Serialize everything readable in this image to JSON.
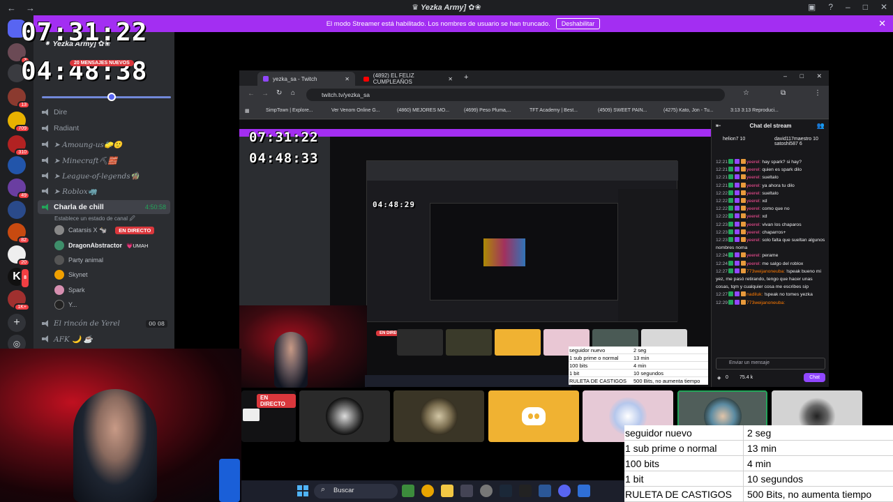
{
  "window": {
    "title": "♛ Yezka Army] ✿❀",
    "back": "←",
    "forward": "→"
  },
  "streamer_banner": {
    "message": "El modo Streamer está habilitado. Los nombres de usuario se han truncado.",
    "button": "Deshabilitar",
    "close": "✕"
  },
  "clocks": {
    "top": "07:31:22",
    "bottom": "04:48:38",
    "nested_top": "07:31:22",
    "nested_bottom": "04:48:33",
    "nested_small": "04:48:29",
    "banner_text": "20 MENSAJES NUEVOS"
  },
  "server_badges": [
    "3",
    "",
    "13",
    "709",
    "310",
    "",
    "49",
    "",
    "82",
    "20",
    "8",
    "1K+"
  ],
  "channels": {
    "server_name": "⁕ Yezka Army] ✿❀",
    "items": [
      {
        "label": "Dire",
        "italic": false
      },
      {
        "label": "Radiant",
        "italic": false
      },
      {
        "label": "➤ Amoung-us🧽🙂",
        "italic": true
      },
      {
        "label": "➤ Minecraft⛏🧱",
        "italic": true
      },
      {
        "label": "➤ League-of-legends🧌",
        "italic": true
      },
      {
        "label": "➤ Roblox🦏",
        "italic": true
      }
    ],
    "active": {
      "label": "Charla de chill",
      "timer": "4:50:58",
      "status": "Establece un estado de canal 🖉"
    },
    "users": [
      {
        "name": "Catarsis X 🐄",
        "live": "EN DIRECTO",
        "color": "#888"
      },
      {
        "name": "DragonAbstractor",
        "tag": "💗UMAH",
        "color": "#3e8e6a"
      },
      {
        "name": "Party animal",
        "color": "#555"
      },
      {
        "name": "Skynet",
        "color": "#f0a000"
      },
      {
        "name": "Spark",
        "color": "#d68fb0"
      },
      {
        "name": "Y...",
        "color": "#222"
      }
    ],
    "after": [
      {
        "label": "El rincón de Yerel",
        "counter": "00 08"
      },
      {
        "label": "AFK 🌙 ☕",
        "counter": ""
      }
    ]
  },
  "browser": {
    "tabs": [
      {
        "label": "yezka_sa - Twitch",
        "active": true
      },
      {
        "label": "(4892) EL FELIZ CUMPLEAÑOS",
        "active": false
      }
    ],
    "url": "twitch.tv/yezka_sa",
    "bookmarks": [
      "SimpTown | Explore...",
      "Ver Venom Online G...",
      "(4860) MEJORES MO...",
      "(4699) Peso Pluma,...",
      "TFT Academy | Best...",
      "(4509) SWEET PAIN...",
      "(4275) Kato, Jon - Tu...",
      "3:13 3:13 Reproduci..."
    ]
  },
  "chat": {
    "header": "Chat del stream",
    "gifts": [
      {
        "name": "helion7",
        "count": "10"
      },
      {
        "name": "david117maestro",
        "count": "10"
      },
      {
        "name": "satoshi587",
        "count": "6"
      }
    ],
    "messages": [
      {
        "time": "12:21",
        "user": "yeerel:",
        "text": "hay spark? si hay?"
      },
      {
        "time": "12:21",
        "user": "yeerel:",
        "text": "quien es spark dilo"
      },
      {
        "time": "12:21",
        "user": "yeerel:",
        "text": "sueltalo"
      },
      {
        "time": "12:21",
        "user": "yeerel:",
        "text": "ya ahora tu dilo"
      },
      {
        "time": "12:22",
        "user": "yeerel:",
        "text": "sueltalo"
      },
      {
        "time": "12:22",
        "user": "yeerel:",
        "text": "xd"
      },
      {
        "time": "12:22",
        "user": "yeerel:",
        "text": "como que no"
      },
      {
        "time": "12:22",
        "user": "yeerel:",
        "text": "xd"
      },
      {
        "time": "12:23",
        "user": "yeerel:",
        "text": "vivan los chaparos"
      },
      {
        "time": "12:23",
        "user": "yeerel:",
        "text": "chaparros+"
      },
      {
        "time": "12:23",
        "user": "yeerel:",
        "text": "solo falta que sueltan algunos nombres noma"
      },
      {
        "time": "12:24",
        "user": "yeerel:",
        "text": "perame"
      },
      {
        "time": "12:24",
        "user": "yeerel:",
        "text": "me salgo del roblox"
      },
      {
        "time": "12:27",
        "user": "773weijanoneuba:",
        "text": "!speak bueno mi yez, me pasó retirando, tengo que hacer unas cosas, tqm y cualquier cosa me escribes sip"
      },
      {
        "time": "12:27",
        "user": "nadiluk:",
        "text": "!speak no tomes yezka"
      },
      {
        "time": "12:29",
        "user": "773weijanoneuba:",
        "text": ""
      }
    ],
    "input_placeholder": "Enviar un mensaje",
    "points": "0",
    "viewers": "75.4 k",
    "chat_button": "Chat"
  },
  "live_badge": "EN DIRECTO",
  "punishments": {
    "rows": [
      {
        "event": "seguidor nuevo",
        "penalty": "2 seg"
      },
      {
        "event": "1 sub prime o normal",
        "penalty": "13 min"
      },
      {
        "event": "100 bits",
        "penalty": "4 min"
      },
      {
        "event": "1 bit",
        "penalty": "10 segundos"
      },
      {
        "event": "RULETA DE CASTIGOS",
        "penalty": "500 Bits, no aumenta tiempo"
      }
    ]
  },
  "taskbar": {
    "search_placeholder": "Buscar"
  },
  "colors": {
    "accent": "#a32ef2",
    "discord": "#5865f2",
    "twitch": "#9147ff",
    "live": "#da373c",
    "discord_tile": "#f0b232"
  }
}
